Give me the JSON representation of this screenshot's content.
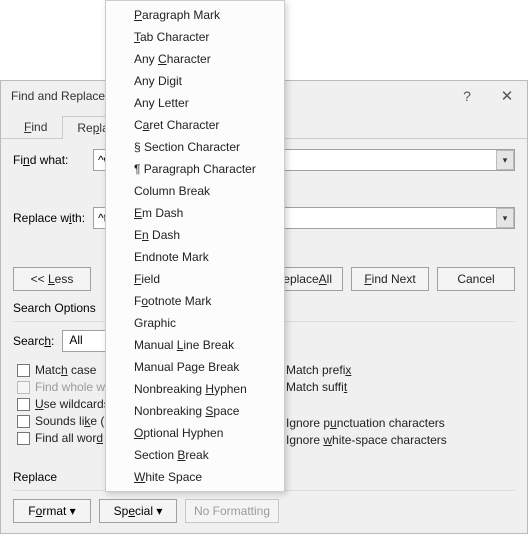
{
  "dialog": {
    "title": "Find and Replace",
    "tabs": {
      "find": "Find",
      "replace": "Replace"
    },
    "find_label": "Find what:",
    "find_value": "^w",
    "replace_label": "Replace with:",
    "replace_value": "^t",
    "buttons": {
      "less": "<<  Less",
      "replace_all": "Replace All",
      "find_next": "Find Next",
      "cancel": "Cancel"
    },
    "search_options_label": "Search Options",
    "search_label": "Search:",
    "search_value": "All",
    "checks": {
      "match_case": "Match case",
      "whole_words": "Find whole words only",
      "wildcards": "Use wildcards",
      "sounds_like": "Sounds like (English)",
      "find_all_forms": "Find all word forms (English)",
      "match_prefix": "Match prefix",
      "match_suffix": "Match suffix",
      "ignore_punct": "Ignore punctuation characters",
      "ignore_ws": "Ignore white-space characters"
    },
    "replace_section_label": "Replace",
    "format_btn": "Format",
    "special_btn": "Special",
    "no_formatting_btn": "No Formatting"
  },
  "accel": {
    "match_case": "h",
    "whole_words_seg1": "Find whole w",
    "whole_words_seg2": "o",
    "whole_words_seg3": "rds only",
    "wildcards": "U",
    "sounds_like_u": "K",
    "find_all_forms": "d",
    "prefix": "x",
    "suffix": "t",
    "ignore_punct": "u",
    "ignore_ws": "w"
  },
  "menu": {
    "items": [
      {
        "label": "Paragraph Mark",
        "u": "P"
      },
      {
        "label": "Tab Character",
        "u": "T"
      },
      {
        "label": "Any Character",
        "u": "C"
      },
      {
        "label": "Any Digit",
        "u": ""
      },
      {
        "label": "Any Letter",
        "u": ""
      },
      {
        "label": "Caret Character",
        "u": "a"
      },
      {
        "label": "§ Section Character",
        "u": ""
      },
      {
        "label": "¶ Paragraph Character",
        "u": ""
      },
      {
        "label": "Column Break",
        "u": ""
      },
      {
        "label": "Em Dash",
        "u": "E"
      },
      {
        "label": "En Dash",
        "u": "n"
      },
      {
        "label": "Endnote Mark",
        "u": ""
      },
      {
        "label": "Field",
        "u": "F"
      },
      {
        "label": "Footnote Mark",
        "u": "o"
      },
      {
        "label": "Graphic",
        "u": ""
      },
      {
        "label": "Manual Line Break",
        "u": "L"
      },
      {
        "label": "Manual Page Break",
        "u": "g"
      },
      {
        "label": "Nonbreaking Hyphen",
        "u": "H"
      },
      {
        "label": "Nonbreaking Space",
        "u": "S"
      },
      {
        "label": "Optional Hyphen",
        "u": "O"
      },
      {
        "label": "Section Break",
        "u": "B"
      },
      {
        "label": "White Space",
        "u": "W"
      }
    ]
  }
}
